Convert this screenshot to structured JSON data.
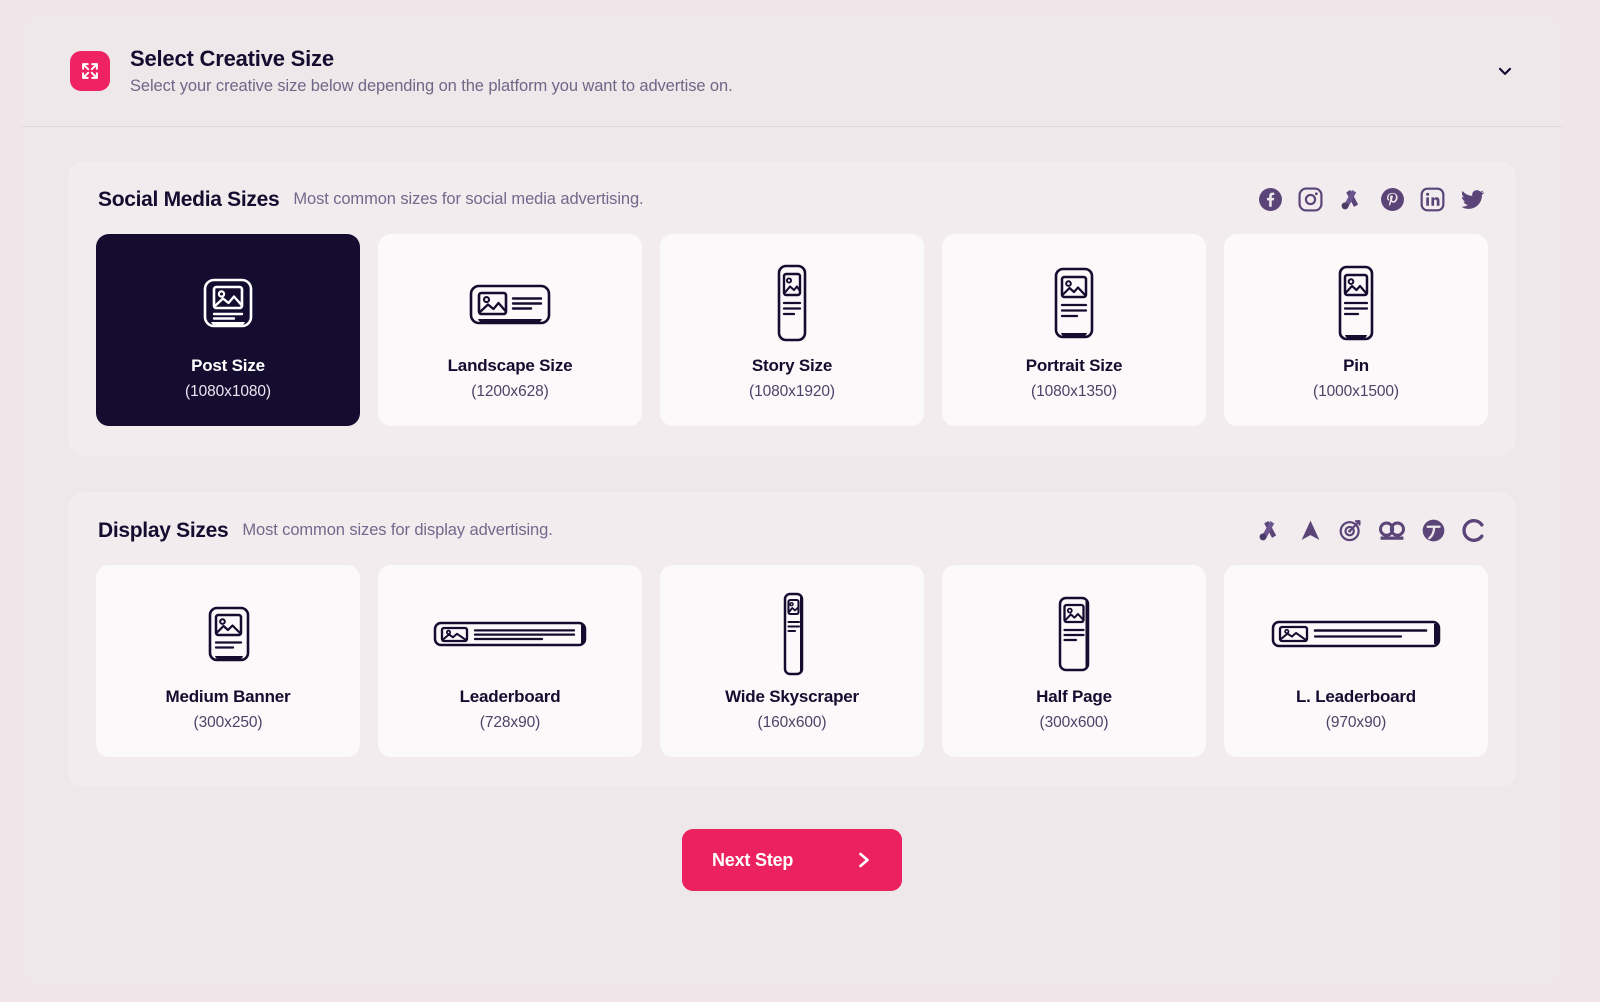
{
  "header": {
    "icon": "expand-arrows-icon",
    "title": "Select Creative Size",
    "subtitle": "Select your creative size below depending on the platform you want to advertise on.",
    "collapse_icon": "chevron-down-icon",
    "accent_color": "#ef2263"
  },
  "sections": [
    {
      "id": "social-media-sizes",
      "title": "Social Media Sizes",
      "subtitle": "Most common sizes for social media advertising.",
      "platform_icons": [
        "facebook-icon",
        "instagram-icon",
        "google-ads-icon",
        "pinterest-icon",
        "linkedin-icon",
        "twitter-icon"
      ],
      "cards": [
        {
          "name": "Post Size",
          "dimensions": "(1080x1080)",
          "art": "square-post-icon",
          "selected": true
        },
        {
          "name": "Landscape Size",
          "dimensions": "(1200x628)",
          "art": "landscape-post-icon",
          "selected": false
        },
        {
          "name": "Story Size",
          "dimensions": "(1080x1920)",
          "art": "story-post-icon",
          "selected": false
        },
        {
          "name": "Portrait Size",
          "dimensions": "(1080x1350)",
          "art": "portrait-post-icon",
          "selected": false
        },
        {
          "name": "Pin",
          "dimensions": "(1000x1500)",
          "art": "pin-post-icon",
          "selected": false
        }
      ]
    },
    {
      "id": "display-sizes",
      "title": "Display Sizes",
      "subtitle": "Most common sizes for display advertising.",
      "platform_icons": [
        "google-ads-icon",
        "adroll-icon",
        "target-dart-icon",
        "outbrain-icon",
        "taboola-icon",
        "criteo-icon"
      ],
      "cards": [
        {
          "name": "Medium Banner",
          "dimensions": "(300x250)",
          "art": "medium-banner-icon",
          "selected": false
        },
        {
          "name": "Leaderboard",
          "dimensions": "(728x90)",
          "art": "leaderboard-icon",
          "selected": false
        },
        {
          "name": "Wide Skyscraper",
          "dimensions": "(160x600)",
          "art": "skyscraper-icon",
          "selected": false
        },
        {
          "name": "Half Page",
          "dimensions": "(300x600)",
          "art": "half-page-icon",
          "selected": false
        },
        {
          "name": "L. Leaderboard",
          "dimensions": "(970x90)",
          "art": "large-leaderboard-icon",
          "selected": false
        }
      ]
    }
  ],
  "footer": {
    "next_label": "Next Step",
    "next_icon": "chevron-right-icon",
    "button_color": "#ec2260"
  }
}
